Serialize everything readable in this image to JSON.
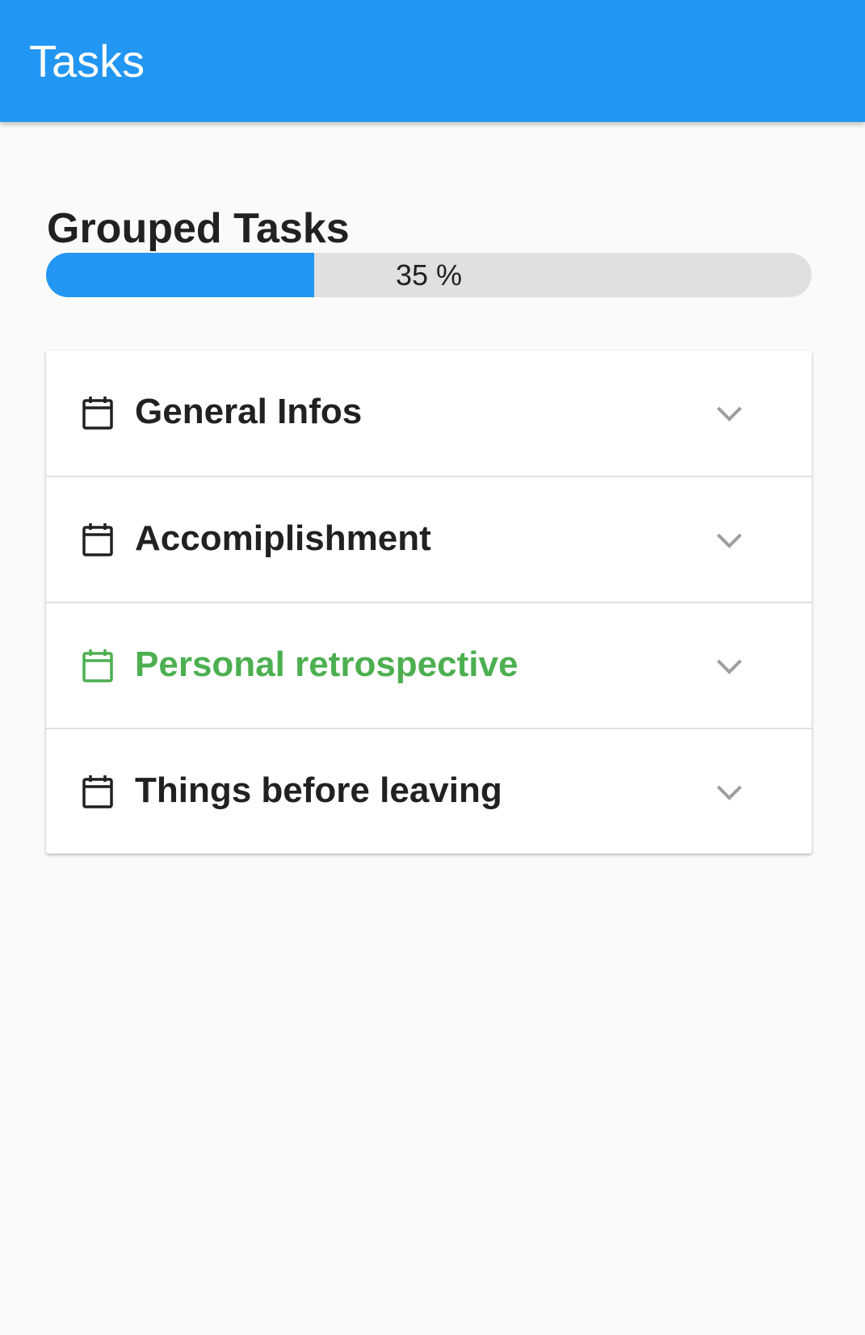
{
  "app_bar": {
    "title": "Tasks"
  },
  "main": {
    "section_title": "Grouped Tasks",
    "progress": {
      "value": 0.35,
      "label": "35 %"
    }
  },
  "groups": [
    {
      "label": "General Infos",
      "icon": "calendar-icon",
      "expanded": false,
      "highlighted": false
    },
    {
      "label": "Accomiplishment",
      "icon": "calendar-icon",
      "expanded": false,
      "highlighted": false
    },
    {
      "label": "Personal retrospective",
      "icon": "calendar-icon",
      "expanded": false,
      "highlighted": true
    },
    {
      "label": "Things before leaving",
      "icon": "calendar-icon",
      "expanded": false,
      "highlighted": false
    }
  ],
  "colors": {
    "primary": "#2196f3",
    "highlight": "#4caf50",
    "text": "#212121",
    "track": "#e0e0e0",
    "chevron": "#9e9e9e"
  }
}
